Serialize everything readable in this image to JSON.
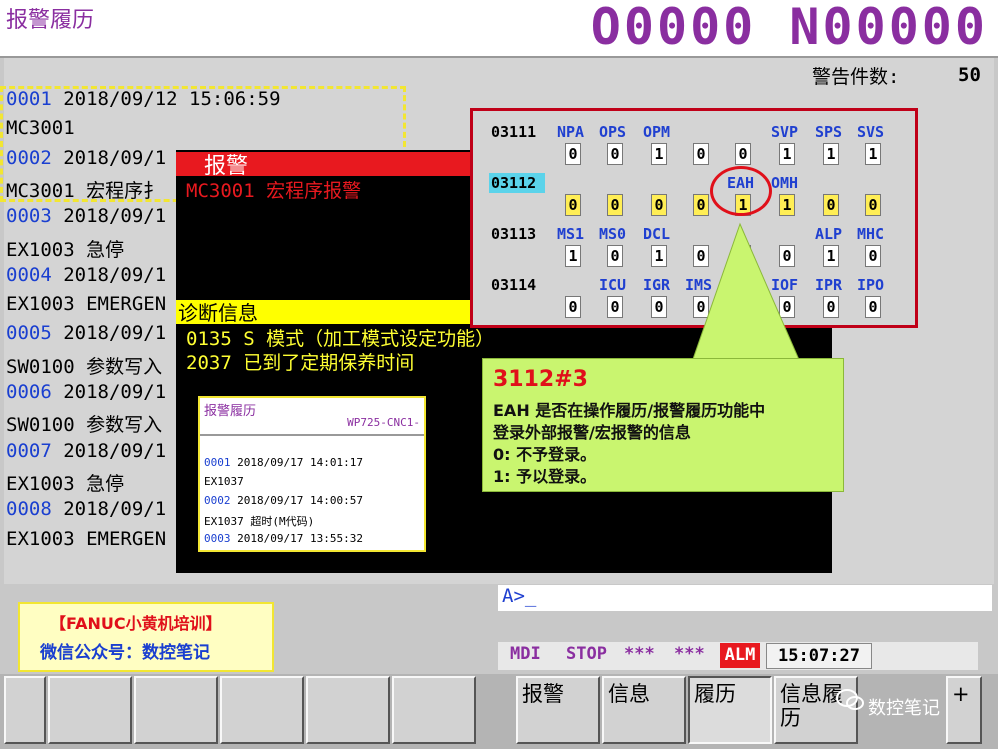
{
  "header": {
    "title": "报警履历",
    "program": "O0000 N00000"
  },
  "alarm_count": {
    "label": "警告件数:",
    "value": "50"
  },
  "history": [
    {
      "no": "0001",
      "date": " 2018/09/12 15:06:59"
    },
    {
      "code": "MC3001"
    },
    {
      "no": "0002",
      "date": " 2018/09/1"
    },
    {
      "code": "MC3001 宏程序扌"
    },
    {
      "no": "0003",
      "date": " 2018/09/1"
    },
    {
      "code": "EX1003 急停"
    },
    {
      "no": "0004",
      "date": " 2018/09/1"
    },
    {
      "code": "EX1003 EMERGEN"
    },
    {
      "no": "0005",
      "date": " 2018/09/1"
    },
    {
      "code": "SW0100 参数写入"
    },
    {
      "no": "0006",
      "date": " 2018/09/1"
    },
    {
      "code": "SW0100 参数写入"
    },
    {
      "no": "0007",
      "date": " 2018/09/1"
    },
    {
      "code": "EX1003 急停"
    },
    {
      "no": "0008",
      "date": " 2018/09/1"
    },
    {
      "code": "EX1003 EMERGEN"
    }
  ],
  "alarm_popup": {
    "label": "报警",
    "text": "MC3001 宏程序报警"
  },
  "diag_popup": {
    "label": "诊断信息",
    "lines": [
      "0135 S 模式（加工模式设定功能）",
      "2037 已到了定期保养时间"
    ]
  },
  "param": {
    "rows": [
      {
        "no": "03111",
        "names": [
          "NPA",
          "OPS",
          "OPM",
          "",
          "",
          "SVP",
          "SPS",
          "SVS"
        ],
        "bits": [
          "0",
          "0",
          "1",
          "0",
          "0",
          "1",
          "1",
          "1"
        ]
      },
      {
        "no": "03112",
        "names": [
          "",
          "",
          "",
          "",
          "EAH",
          "OMH",
          "",
          ""
        ],
        "bits": [
          "0",
          "0",
          "0",
          "0",
          "1",
          "1",
          "0",
          "0"
        ]
      },
      {
        "no": "03113",
        "names": [
          "MS1",
          "MS0",
          "DCL",
          "",
          "",
          "",
          "ALP",
          "MHC"
        ],
        "bits": [
          "1",
          "0",
          "1",
          "0",
          "0",
          "0",
          "1",
          "0"
        ]
      },
      {
        "no": "03114",
        "names": [
          "",
          "ICU",
          "IGR",
          "IMS",
          "",
          "IOF",
          "IPR",
          "IPO"
        ],
        "bits": [
          "0",
          "0",
          "0",
          "0",
          "0",
          "0",
          "0",
          "0"
        ]
      }
    ]
  },
  "callout": {
    "title": "3112#3",
    "lines": [
      "EAH 是否在操作履历/报警履历功能中",
      "登录外部报警/宏报警的信息",
      "0: 不予登录。",
      "1: 予以登录。"
    ]
  },
  "mini": {
    "title": "报警履历",
    "id": "WP725-CNC1-",
    "lines": [
      {
        "no": "0001",
        "text": " 2018/09/17 14:01:17"
      },
      {
        "text": "EX1037"
      },
      {
        "no": "0002",
        "text": " 2018/09/17 14:00:57"
      },
      {
        "text": "EX1037 超时(M代码)"
      },
      {
        "no": "0003",
        "text": " 2018/09/17 13:55:32"
      }
    ]
  },
  "input": {
    "prompt": "A>_"
  },
  "promo": {
    "line1": "【FANUC小黄机培训】",
    "line2": "微信公众号：数控笔记"
  },
  "status": {
    "mode": "MDI",
    "state": "STOP",
    "s1": "***",
    "s2": "***",
    "alm": "ALM",
    "time": "15:07:27"
  },
  "softkeys": [
    "",
    "",
    "",
    "",
    "",
    "",
    "报警",
    "信息",
    "履历",
    "信息履历",
    "+"
  ],
  "watermark": "数控笔记"
}
